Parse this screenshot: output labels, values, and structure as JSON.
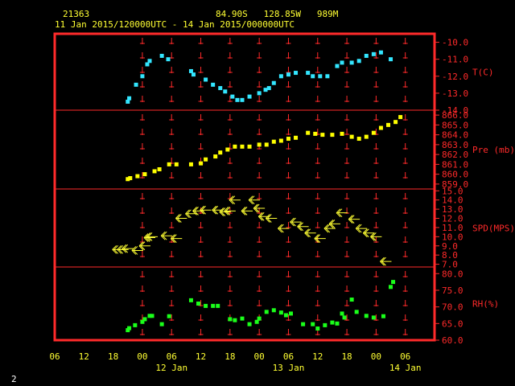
{
  "header": {
    "station": "21363",
    "location": "84.90S   128.85W   989M",
    "period": "11 Jan 2015/120000UTC - 14 Jan 2015/000000UTC"
  },
  "footer": {
    "page": "2"
  },
  "colors": {
    "frame": "#ff2a2a",
    "text": "#ffff33",
    "temp": "#33e6ff",
    "pres": "#ffff00",
    "wind": "#ffff33",
    "rh": "#1aff1a"
  },
  "chart_data": {
    "type": "scatter",
    "x_unit": "hours from 11 Jan 2015 06 UTC",
    "x_ticks": [
      "06",
      "12",
      "18",
      "00",
      "06",
      "12",
      "18",
      "00",
      "06",
      "12",
      "18",
      "00",
      "06"
    ],
    "date_labels": [
      {
        "label": "12 Jan",
        "hour": 18
      },
      {
        "label": "13 Jan",
        "hour": 42
      },
      {
        "label": "14 Jan",
        "hour": 66
      }
    ],
    "panels": [
      {
        "name": "T(C)",
        "key": "temp",
        "ylim": [
          -14,
          -9.5
        ],
        "ticks": [
          -10,
          -11,
          -12,
          -13,
          -14
        ],
        "tick_labels": [
          "-10.0",
          "-11.0",
          "-12.0",
          "-13.0",
          "-14.0"
        ],
        "points": [
          [
            9,
            -13.5
          ],
          [
            9.3,
            -13.3
          ],
          [
            10.7,
            -12.5
          ],
          [
            12,
            -12
          ],
          [
            13,
            -11.3
          ],
          [
            13.5,
            -11.1
          ],
          [
            16,
            -10.8
          ],
          [
            17.3,
            -11
          ],
          [
            22,
            -11.7
          ],
          [
            22.5,
            -11.9
          ],
          [
            25,
            -12.2
          ],
          [
            26.5,
            -12.5
          ],
          [
            28,
            -12.7
          ],
          [
            29,
            -12.9
          ],
          [
            30.5,
            -13.2
          ],
          [
            31.5,
            -13.4
          ],
          [
            32.5,
            -13.4
          ],
          [
            34,
            -13.2
          ],
          [
            36,
            -13
          ],
          [
            37.3,
            -12.8
          ],
          [
            38,
            -12.7
          ],
          [
            39,
            -12.4
          ],
          [
            40.5,
            -12
          ],
          [
            42,
            -11.9
          ],
          [
            43.5,
            -11.8
          ],
          [
            46,
            -11.8
          ],
          [
            47,
            -12
          ],
          [
            48.5,
            -12
          ],
          [
            50,
            -12
          ],
          [
            52,
            -11.4
          ],
          [
            53,
            -11.2
          ],
          [
            55,
            -11.2
          ],
          [
            56.5,
            -11.1
          ],
          [
            58,
            -10.8
          ],
          [
            59.5,
            -10.7
          ],
          [
            61,
            -10.6
          ],
          [
            63,
            -11
          ]
        ]
      },
      {
        "name": "Pre (mb)",
        "key": "pres",
        "ylim": [
          858.5,
          866.5
        ],
        "ticks": [
          859,
          860,
          861,
          862,
          863,
          864,
          865,
          866
        ],
        "tick_labels": [
          "859.0",
          "860.0",
          "861.0",
          "862.0",
          "863.0",
          "864.0",
          "865.0",
          "866.0"
        ],
        "points": [
          [
            9,
            859.5
          ],
          [
            9.5,
            859.6
          ],
          [
            11,
            859.8
          ],
          [
            12.5,
            860
          ],
          [
            14.5,
            860.3
          ],
          [
            15.5,
            860.5
          ],
          [
            17.5,
            861
          ],
          [
            19,
            861
          ],
          [
            22,
            861
          ],
          [
            24,
            861.1
          ],
          [
            25,
            861.5
          ],
          [
            27,
            861.8
          ],
          [
            28,
            862.2
          ],
          [
            29.5,
            862.5
          ],
          [
            31,
            862.8
          ],
          [
            32.5,
            862.8
          ],
          [
            34,
            862.8
          ],
          [
            36,
            863
          ],
          [
            37.5,
            863
          ],
          [
            39,
            863.3
          ],
          [
            40.5,
            863.4
          ],
          [
            42,
            863.6
          ],
          [
            43.5,
            863.7
          ],
          [
            46,
            864.2
          ],
          [
            47.5,
            864.1
          ],
          [
            49,
            864
          ],
          [
            51,
            864
          ],
          [
            53,
            864.1
          ],
          [
            55,
            863.8
          ],
          [
            56.5,
            863.6
          ],
          [
            58,
            863.8
          ],
          [
            59.5,
            864.2
          ],
          [
            61,
            864.7
          ],
          [
            62.5,
            865
          ],
          [
            64,
            865.3
          ],
          [
            65,
            865.8
          ]
        ]
      },
      {
        "name": "SPD(MPS)",
        "key": "wind",
        "ylim": [
          6.7,
          15.2
        ],
        "ticks": [
          7,
          8,
          9,
          10,
          11,
          12,
          13,
          14,
          15
        ],
        "tick_labels": [
          "7.0",
          "8.0",
          "9.0",
          "10.0",
          "11.0",
          "12.0",
          "13.0",
          "14.0",
          "15.0"
        ],
        "points": [
          [
            7,
            8.6
          ],
          [
            8,
            8.6
          ],
          [
            9,
            8.7
          ],
          [
            11,
            8.5
          ],
          [
            12.5,
            9
          ],
          [
            13.5,
            9.9
          ],
          [
            14,
            10
          ],
          [
            17,
            10.1
          ],
          [
            19,
            9.8
          ],
          [
            20,
            12
          ],
          [
            22,
            12.5
          ],
          [
            23.5,
            12.8
          ],
          [
            25,
            12.9
          ],
          [
            27.5,
            12.9
          ],
          [
            29,
            12.7
          ],
          [
            30,
            12.8
          ],
          [
            31,
            14
          ],
          [
            33.5,
            12.8
          ],
          [
            35,
            14
          ],
          [
            36,
            13.1
          ],
          [
            37,
            12.2
          ],
          [
            38.5,
            12
          ],
          [
            41,
            10.9
          ],
          [
            43.5,
            11.6
          ],
          [
            45,
            11.1
          ],
          [
            46.5,
            10.4
          ],
          [
            48.5,
            9.8
          ],
          [
            50.5,
            10.9
          ],
          [
            51.5,
            11.4
          ],
          [
            53,
            12.6
          ],
          [
            55.5,
            11.9
          ],
          [
            57,
            10.9
          ],
          [
            58.5,
            10.4
          ],
          [
            60,
            10
          ],
          [
            62,
            7.3
          ]
        ]
      },
      {
        "name": "RH(%)",
        "key": "rh",
        "ylim": [
          60,
          82
        ],
        "ticks": [
          60,
          65,
          70,
          75,
          80
        ],
        "tick_labels": [
          "60.0",
          "65.0",
          "70.0",
          "75.0",
          "80.0"
        ],
        "points": [
          [
            9,
            63
          ],
          [
            9.3,
            63.6
          ],
          [
            10.5,
            64.5
          ],
          [
            12,
            65.5
          ],
          [
            12.5,
            66.3
          ],
          [
            13.5,
            67.3
          ],
          [
            14,
            67.3
          ],
          [
            16,
            64.8
          ],
          [
            17.5,
            67.2
          ],
          [
            22,
            72
          ],
          [
            23.5,
            71
          ],
          [
            25,
            70.3
          ],
          [
            26.5,
            70.3
          ],
          [
            27.5,
            70.3
          ],
          [
            30,
            66.3
          ],
          [
            31,
            66
          ],
          [
            32.5,
            66.5
          ],
          [
            34,
            64.8
          ],
          [
            35.5,
            65.5
          ],
          [
            36,
            66.5
          ],
          [
            37.5,
            68.5
          ],
          [
            39,
            69
          ],
          [
            40.5,
            68.3
          ],
          [
            41.5,
            67.5
          ],
          [
            42.5,
            68
          ],
          [
            45,
            64.8
          ],
          [
            47,
            64.8
          ],
          [
            48,
            63.5
          ],
          [
            49.5,
            64.5
          ],
          [
            51,
            65.3
          ],
          [
            52,
            65
          ],
          [
            53,
            68
          ],
          [
            53.5,
            66.8
          ],
          [
            55,
            72.2
          ],
          [
            56,
            68.5
          ],
          [
            58,
            67.3
          ],
          [
            59.5,
            66.8
          ],
          [
            61.5,
            67.2
          ],
          [
            63,
            76
          ],
          [
            63.5,
            77.5
          ]
        ]
      }
    ]
  }
}
